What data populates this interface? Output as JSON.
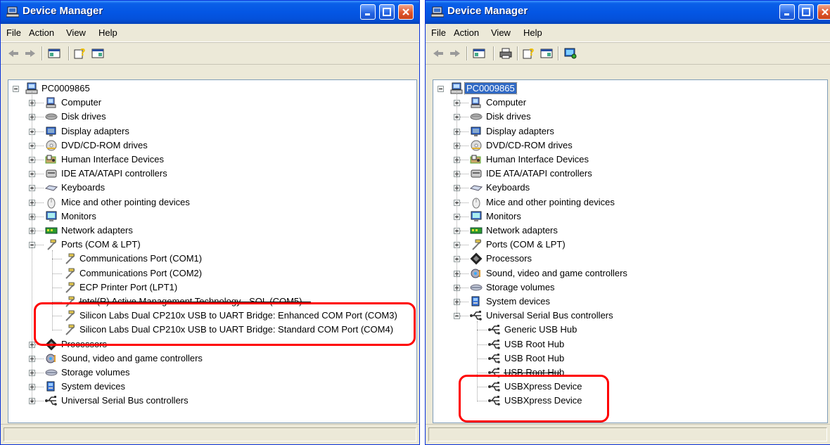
{
  "window_title": "Device Manager",
  "menu": [
    "File",
    "Action",
    "View",
    "Help"
  ],
  "root": "PC0009865",
  "left": {
    "categories_top": [
      "Computer",
      "Disk drives",
      "Display adapters",
      "DVD/CD-ROM drives",
      "Human Interface Devices",
      "IDE ATA/ATAPI controllers",
      "Keyboards",
      "Mice and other pointing devices",
      "Monitors",
      "Network adapters"
    ],
    "ports": "Ports (COM & LPT)",
    "port_items": [
      "Communications Port (COM1)",
      "Communications Port (COM2)",
      "ECP Printer Port (LPT1)",
      "Intel(R) Active Management Technology - SOL (COM5)",
      "Silicon Labs Dual CP210x USB to UART Bridge: Enhanced COM Port (COM3)",
      "Silicon Labs Dual CP210x USB to UART Bridge: Standard COM Port (COM4)"
    ],
    "categories_bottom": [
      "Processors",
      "Sound, video and game controllers",
      "Storage volumes",
      "System devices",
      "Universal Serial Bus controllers"
    ]
  },
  "right": {
    "categories_top": [
      "Computer",
      "Disk drives",
      "Display adapters",
      "DVD/CD-ROM drives",
      "Human Interface Devices",
      "IDE ATA/ATAPI controllers",
      "Keyboards",
      "Mice and other pointing devices",
      "Monitors",
      "Network adapters",
      "Ports (COM & LPT)",
      "Processors",
      "Sound, video and game controllers",
      "Storage volumes",
      "System devices"
    ],
    "usb": "Universal Serial Bus controllers",
    "usb_items": [
      "Generic USB Hub",
      "USB Root Hub",
      "USB Root Hub",
      "USB Root Hub",
      "USBXpress Device",
      "USBXpress Device"
    ]
  },
  "icons": {
    "top": [
      "computer-icon",
      "disk-drive-icon",
      "display-adapter-icon",
      "dvd-icon",
      "hid-icon",
      "ide-controller-icon",
      "keyboard-icon",
      "mouse-icon",
      "monitor-icon",
      "network-adapter-icon",
      "port-icon",
      "processor-icon",
      "sound-icon",
      "storage-volume-icon",
      "system-devices-icon"
    ],
    "usb": "usb-icon",
    "port": "port-icon"
  },
  "colors": {
    "titlebar": "#0456e4",
    "highlight": "#ff0000",
    "selection": "#316ac5"
  }
}
